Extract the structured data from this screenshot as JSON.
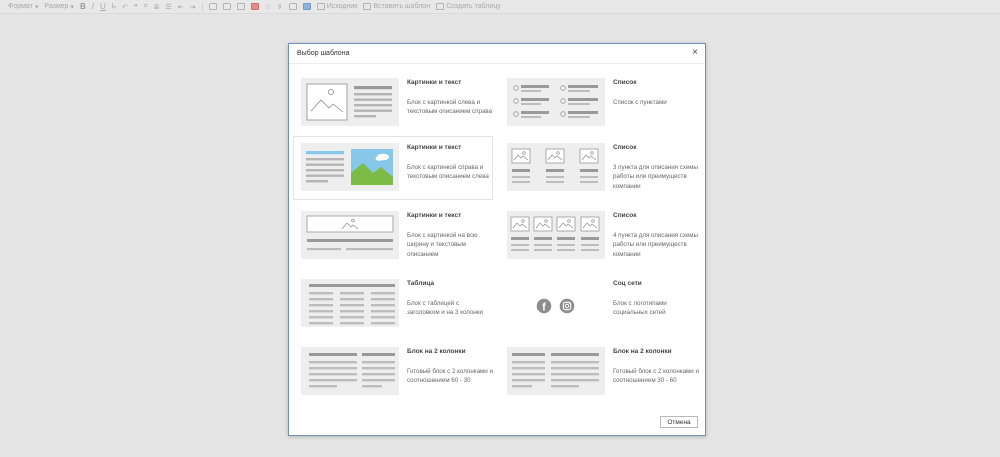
{
  "toolbar": {
    "format_label": "Формат",
    "size_label": "Размер",
    "source_label": "Исходник",
    "insert_template_label": "Вставить шаблон",
    "create_table_label": "Создать таблицу"
  },
  "dialog": {
    "title": "Выбор шаблона",
    "close_glyph": "×",
    "cancel_label": "Отмена"
  },
  "templates": [
    {
      "title": "Картинки и текст",
      "desc": "Блок с картинкой слева и текстовым описанием справа"
    },
    {
      "title": "Список",
      "desc": "Список с пунктами"
    },
    {
      "title": "Картинки и текст",
      "desc": "Блок с картинкой справа и текстовым описанием слева"
    },
    {
      "title": "Список",
      "desc": "3 пункта для описания схемы работы или преимуществ компании"
    },
    {
      "title": "Картинки и текст",
      "desc": "Блок с картинкой на всю ширину и текстовым описанием"
    },
    {
      "title": "Список",
      "desc": "4 пункта для описания схемы работы или преимуществ компании"
    },
    {
      "title": "Таблица",
      "desc": "Блок с таблицей с заголовком и на 3 колонки"
    },
    {
      "title": "Соц сети",
      "desc": "Блок с логотипами социальных сетей"
    },
    {
      "title": "Блок на 2 колонки",
      "desc": "Готовый блок с 2 колонками и соотношением 60 - 30"
    },
    {
      "title": "Блок на 2 колонки",
      "desc": "Готовый блок с 2 колонками и соотношением 30 - 60"
    }
  ],
  "colors": {
    "dialog_border": "#6f8fbf",
    "thumb_sky": "#87c7ea",
    "thumb_grass": "#7cbc46",
    "thumb_line_blue": "#87c7ea",
    "placeholder_gray": "#9a9a9a"
  }
}
